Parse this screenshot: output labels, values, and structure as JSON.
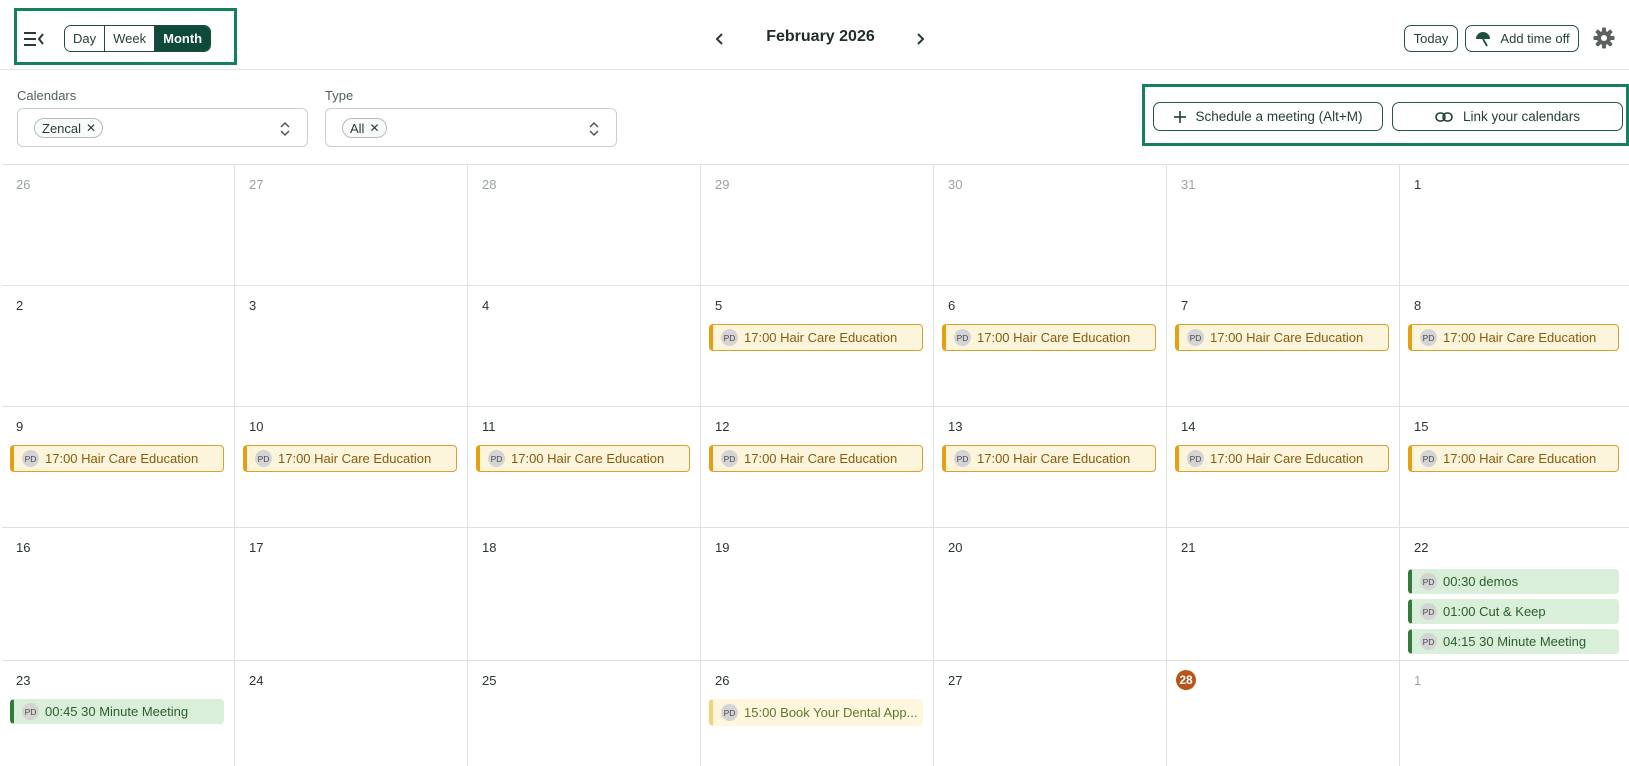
{
  "header": {
    "views": [
      {
        "label": "Day",
        "active": false
      },
      {
        "label": "Week",
        "active": false
      },
      {
        "label": "Month",
        "active": true
      }
    ],
    "month_title": "February 2026",
    "today_label": "Today",
    "timeoff_label": "Add time off"
  },
  "filters": {
    "calendars_label": "Calendars",
    "calendars_chip": "Zencal",
    "type_label": "Type",
    "type_chip": "All"
  },
  "actions": {
    "schedule_label": "Schedule a meeting (Alt+M)",
    "link_label": "Link your calendars"
  },
  "colors": {
    "brand_dark": "#0d4a3a",
    "highlight": "#15805f",
    "today_badge": "#b9541a",
    "event_amber": "#e4a012",
    "event_green": "#367a3b"
  },
  "weeks": [
    {
      "days": [
        {
          "label": "26",
          "muted": true,
          "events": []
        },
        {
          "label": "27",
          "muted": true,
          "events": []
        },
        {
          "label": "28",
          "muted": true,
          "events": []
        },
        {
          "label": "29",
          "muted": true,
          "events": []
        },
        {
          "label": "30",
          "muted": true,
          "events": []
        },
        {
          "label": "31",
          "muted": true,
          "events": []
        },
        {
          "label": "1",
          "events": []
        }
      ]
    },
    {
      "days": [
        {
          "label": "2",
          "events": []
        },
        {
          "label": "3",
          "events": []
        },
        {
          "label": "4",
          "events": []
        },
        {
          "label": "5",
          "events": [
            {
              "initials": "PD",
              "text": "17:00 Hair Care Education",
              "style": "amber"
            }
          ]
        },
        {
          "label": "6",
          "events": [
            {
              "initials": "PD",
              "text": "17:00 Hair Care Education",
              "style": "amber"
            }
          ]
        },
        {
          "label": "7",
          "events": [
            {
              "initials": "PD",
              "text": "17:00 Hair Care Education",
              "style": "amber"
            }
          ]
        },
        {
          "label": "8",
          "events": [
            {
              "initials": "PD",
              "text": "17:00 Hair Care Education",
              "style": "amber"
            }
          ]
        }
      ]
    },
    {
      "days": [
        {
          "label": "9",
          "events": [
            {
              "initials": "PD",
              "text": "17:00 Hair Care Education",
              "style": "amber"
            }
          ]
        },
        {
          "label": "10",
          "events": [
            {
              "initials": "PD",
              "text": "17:00 Hair Care Education",
              "style": "amber"
            }
          ]
        },
        {
          "label": "11",
          "events": [
            {
              "initials": "PD",
              "text": "17:00 Hair Care Education",
              "style": "amber"
            }
          ]
        },
        {
          "label": "12",
          "events": [
            {
              "initials": "PD",
              "text": "17:00 Hair Care Education",
              "style": "amber"
            }
          ]
        },
        {
          "label": "13",
          "events": [
            {
              "initials": "PD",
              "text": "17:00 Hair Care Education",
              "style": "amber"
            }
          ]
        },
        {
          "label": "14",
          "events": [
            {
              "initials": "PD",
              "text": "17:00 Hair Care Education",
              "style": "amber"
            }
          ]
        },
        {
          "label": "15",
          "events": [
            {
              "initials": "PD",
              "text": "17:00 Hair Care Education",
              "style": "amber"
            }
          ]
        }
      ]
    },
    {
      "days": [
        {
          "label": "16",
          "events": []
        },
        {
          "label": "17",
          "events": []
        },
        {
          "label": "18",
          "events": []
        },
        {
          "label": "19",
          "events": []
        },
        {
          "label": "20",
          "events": []
        },
        {
          "label": "21",
          "events": []
        },
        {
          "label": "22",
          "events": [
            {
              "initials": "PD",
              "text": "00:30 demos",
              "style": "green"
            },
            {
              "initials": "PD",
              "text": "01:00 Cut & Keep",
              "style": "green"
            },
            {
              "initials": "PD",
              "text": "04:15 30 Minute Meeting",
              "style": "green"
            }
          ]
        }
      ]
    },
    {
      "days": [
        {
          "label": "23",
          "events": [
            {
              "initials": "PD",
              "text": "00:45 30 Minute Meeting",
              "style": "green"
            }
          ]
        },
        {
          "label": "24",
          "events": []
        },
        {
          "label": "25",
          "events": []
        },
        {
          "label": "26",
          "events": [
            {
              "initials": "PD",
              "text": "15:00 Book Your Dental App...",
              "style": "yellow"
            }
          ]
        },
        {
          "label": "27",
          "events": []
        },
        {
          "label": "28",
          "today": true,
          "events": []
        },
        {
          "label": "1",
          "muted": true,
          "events": []
        }
      ]
    }
  ]
}
